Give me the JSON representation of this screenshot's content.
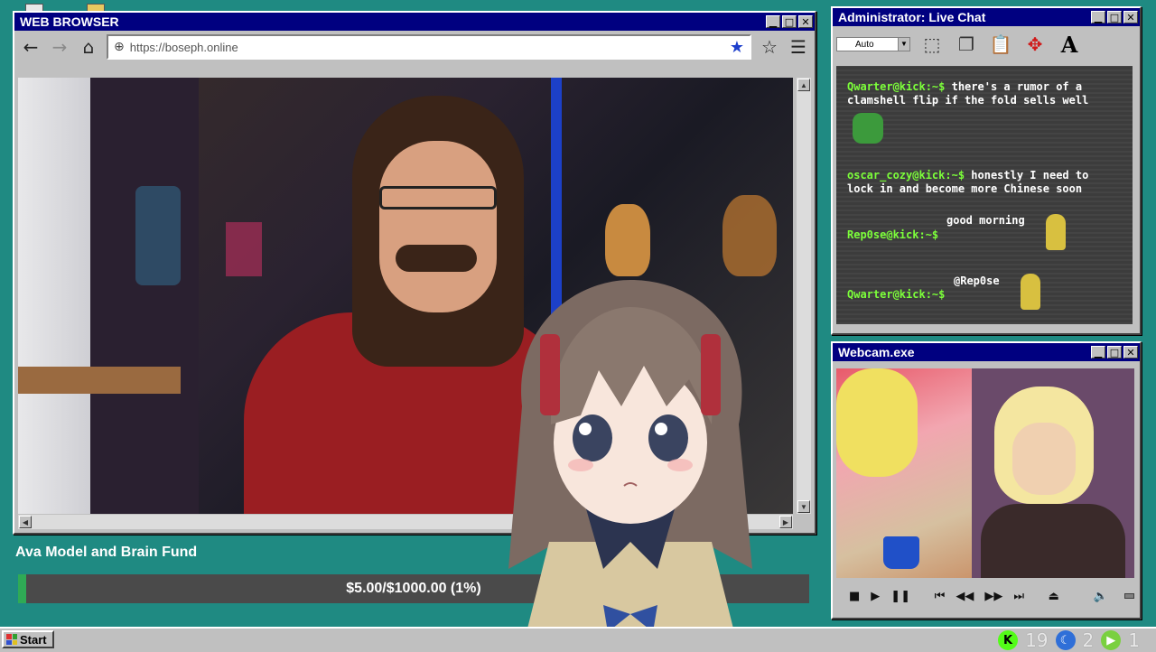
{
  "browser": {
    "title": "WEB BROWSER",
    "url": "https://boseph.online"
  },
  "chat": {
    "title": "Administrator: Live Chat",
    "font_option": "Auto",
    "messages": [
      {
        "user": "Qwarter@kick:~$",
        "text": " there's a rumor of a clamshell flip if the fold sells well"
      },
      {
        "user": "oscar_cozy@kick:~$",
        "text": " honestly I need to lock in and become more Chinese soon"
      },
      {
        "user": "Rep0se@kick:~$",
        "text": "good morning"
      },
      {
        "user": "Qwarter@kick:~$",
        "text": "@Rep0se"
      }
    ]
  },
  "webcam": {
    "title": "Webcam.exe"
  },
  "fund": {
    "title": "Ava Model and Brain Fund",
    "progress_text": "$5.00/$1000.00 (1%)",
    "progress_fraction": 0.01
  },
  "taskbar": {
    "start_label": "Start",
    "tray_count_1": "19",
    "tray_count_2": "2",
    "tray_count_3": "1"
  },
  "colors": {
    "desktop": "#1f8a82",
    "title_bar": "#000080",
    "chat_username": "#7cff3a",
    "fund_fill": "#2faa55",
    "bookmark_star": "#1d3fcc"
  }
}
